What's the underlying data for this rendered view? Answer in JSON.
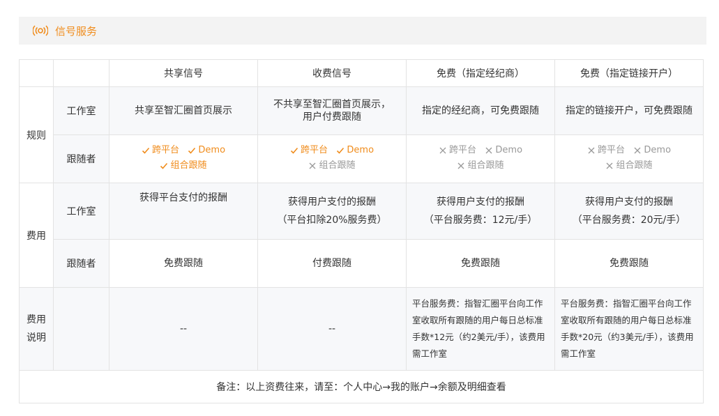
{
  "header": {
    "title": "信号服务",
    "icon": "signal-broadcast-icon",
    "accent": "#f08c1c"
  },
  "columns": [
    "共享信号",
    "收费信号",
    "免费（指定经纪商）",
    "免费（指定链接开户）"
  ],
  "groups": {
    "rules": "规则",
    "cost": "费用",
    "cost_desc": "费用说明"
  },
  "subs": {
    "studio": "工作室",
    "follower": "跟随者"
  },
  "rules_studio": [
    "共享至智汇圈首页展示",
    "不共享至智汇圈首页展示，",
    "用户付费跟随",
    "指定的经纪商，可免费跟随",
    "指定的链接开户，可免费跟随"
  ],
  "features": {
    "cross": "跨平台",
    "demo": "Demo",
    "combo": "组合跟随"
  },
  "cost_studio": {
    "c1": "获得平台支付的报酬",
    "c2_l1": "获得用户支付的报酬",
    "c2_l2": "（平台扣除20%服务费）",
    "c3_l1": "获得用户支付的报酬",
    "c3_l2": "（平台服务费：12元/手）",
    "c4_l1": "获得用户支付的报酬",
    "c4_l2": "（平台服务费：20元/手）"
  },
  "cost_follower": [
    "免费跟随",
    "付费跟随",
    "免费跟随",
    "免费跟随"
  ],
  "cost_desc": {
    "c1": "--",
    "c2": "--",
    "c3": "平台服务费：指智汇圈平台向工作室收取所有跟随的用户每日总标准手数*12元（约2美元/手），该费用需工作室",
    "c4": "平台服务费：指智汇圈平台向工作室收取所有跟随的用户每日总标准手数*20元（约3美元/手），该费用需工作室"
  },
  "note": "备注：以上资费往来，请至：个人中心→我的账户→余额及明细查看"
}
